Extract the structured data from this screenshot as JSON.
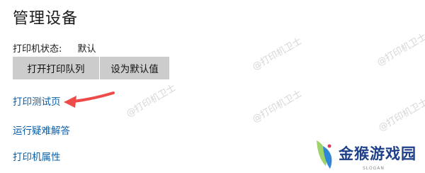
{
  "title": "管理设备",
  "status": {
    "label": "打印机状态:",
    "value": "默认"
  },
  "buttons": {
    "open_queue": "打开打印队列",
    "set_default": "设为默认值"
  },
  "links": {
    "test_page": "打印测试页",
    "troubleshoot": "运行疑难解答",
    "properties": "打印机属性"
  },
  "watermark_text": "@打印机卫士",
  "logo": {
    "text": "金猴游戏园",
    "sub": "SLOGAN"
  },
  "colors": {
    "link": "#0a5fa8",
    "button_bg": "#cccccc",
    "arrow": "#ef4a4a",
    "logo": "#1e3f8a"
  }
}
